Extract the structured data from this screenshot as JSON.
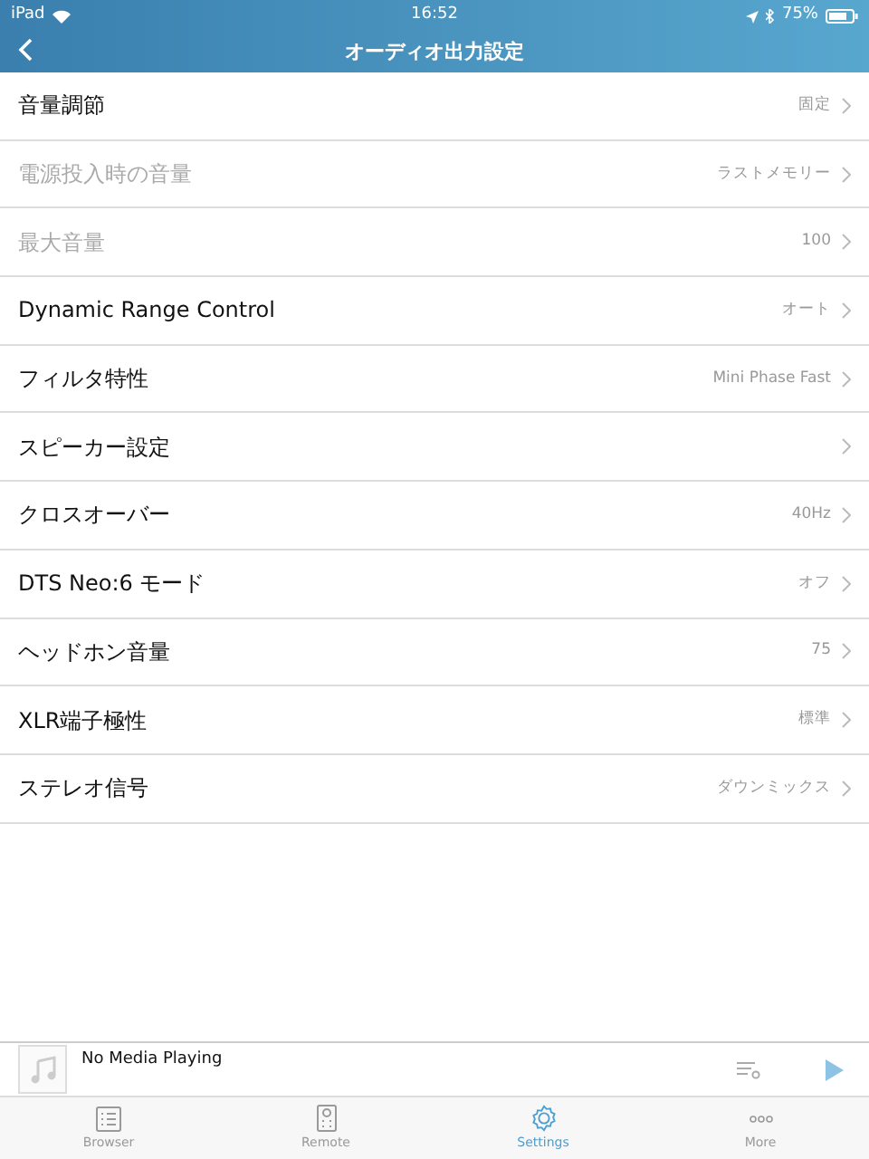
{
  "status_bar": {
    "device": "iPad",
    "time": "16:52",
    "battery": "75%"
  },
  "nav_bar": {
    "title": "オーディオ出力設定"
  },
  "settings": [
    {
      "label": "音量調節",
      "value": "固定",
      "disabled": false
    },
    {
      "label": "電源投入時の音量",
      "value": "ラストメモリー",
      "disabled": true
    },
    {
      "label": "最大音量",
      "value": "100",
      "disabled": true
    },
    {
      "label": "Dynamic Range Control",
      "value": "オート",
      "disabled": false
    },
    {
      "label": "フィルタ特性",
      "value": "Mini Phase Fast",
      "disabled": false
    },
    {
      "label": "スピーカー設定",
      "disabled": false
    },
    {
      "label": "クロスオーバー",
      "value": "40Hz",
      "disabled": false
    },
    {
      "label": "DTS Neo:6 モード",
      "value": "オフ",
      "disabled": false
    },
    {
      "label": "ヘッドホン音量",
      "value": "75",
      "disabled": false
    },
    {
      "label": "XLR端子極性",
      "value": "標準",
      "disabled": false
    },
    {
      "label": "ステレオ信号",
      "value": "ダウンミックス",
      "disabled": false
    }
  ],
  "now_playing": {
    "title": "No Media Playing"
  },
  "tabs": [
    {
      "label": "Browser",
      "kind": "browser",
      "selected": false
    },
    {
      "label": "Remote",
      "kind": "remote",
      "selected": false
    },
    {
      "label": "Settings",
      "kind": "settings",
      "selected": true
    },
    {
      "label": "More",
      "kind": "more",
      "selected": false
    }
  ]
}
